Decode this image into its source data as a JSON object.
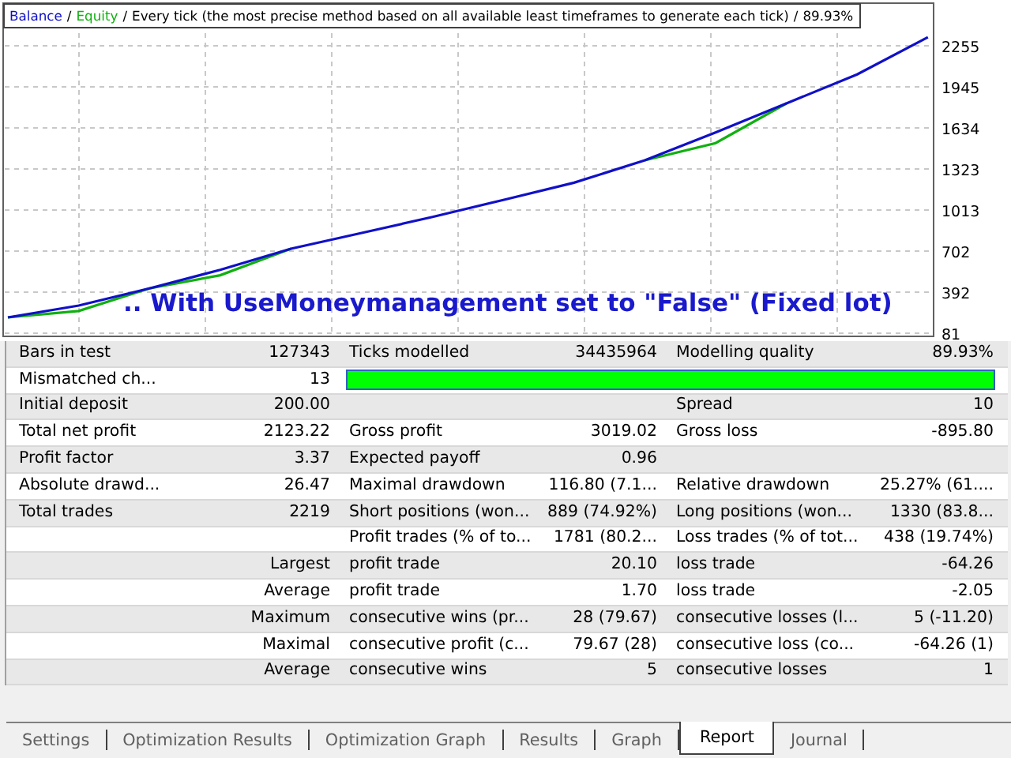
{
  "chart": {
    "header": [
      {
        "text": "Balance",
        "color": "#1010c8"
      },
      {
        "text": "/"
      },
      {
        "text": "Equity",
        "color": "#10b010"
      },
      {
        "text": "/"
      },
      {
        "text": "Every tick (the most precise method based on all available least timeframes to generate each tick)"
      },
      {
        "text": "/"
      },
      {
        "text": "89.93%"
      }
    ],
    "overlay_text": ".. With UseMoneymanagement set to \"False\" (Fixed lot)",
    "y_axis_labels": [
      "2255",
      "1945",
      "1634",
      "1323",
      "1013",
      "702",
      "392",
      "81"
    ]
  },
  "table": {
    "rows": [
      {
        "kind": "pair",
        "cells": [
          "Bars in test",
          "127343",
          "Ticks modelled",
          "34435964",
          "Modelling quality",
          "89.93%"
        ]
      },
      {
        "kind": "quality_bar",
        "cells": [
          "Mismatched ch...",
          "13"
        ],
        "level": 1.0
      },
      {
        "kind": "pair",
        "cells": [
          "Initial deposit",
          "200.00",
          null,
          null,
          "Spread",
          "10"
        ]
      },
      {
        "kind": "pair",
        "cells": [
          "Total net profit",
          "2123.22",
          "Gross profit",
          "3019.02",
          "Gross loss",
          "-895.80"
        ]
      },
      {
        "kind": "pair",
        "cells": [
          "Profit factor",
          "3.37",
          "Expected payoff",
          "0.96",
          null,
          null
        ]
      },
      {
        "kind": "pair",
        "cells": [
          "Absolute drawd...",
          "26.47",
          "Maximal drawdown",
          "116.80 (7.1...",
          "Relative drawdown",
          "25.27% (61...."
        ]
      },
      {
        "kind": "pair",
        "cells": [
          "Total trades",
          "2219",
          "Short positions (won...",
          "889 (74.92%)",
          "Long positions (won...",
          "1330 (83.8..."
        ]
      },
      {
        "kind": "detail",
        "cells": [
          null,
          null,
          "Profit trades (% of to...",
          "1781 (80.2...",
          "Loss trades (% of tot...",
          "438 (19.74%)"
        ]
      },
      {
        "kind": "detail",
        "cells": [
          null,
          "Largest",
          "profit trade",
          "20.10",
          "loss trade",
          "-64.26"
        ]
      },
      {
        "kind": "detail",
        "cells": [
          null,
          "Average",
          "profit trade",
          "1.70",
          "loss trade",
          "-2.05"
        ]
      },
      {
        "kind": "detail",
        "cells": [
          null,
          "Maximum",
          "consecutive wins (pr...",
          "28 (79.67)",
          "consecutive losses (l...",
          "5 (-11.20)"
        ]
      },
      {
        "kind": "detail",
        "cells": [
          null,
          "Maximal",
          "consecutive profit (c...",
          "79.67 (28)",
          "consecutive loss (co...",
          "-64.26 (1)"
        ]
      },
      {
        "kind": "detail",
        "cells": [
          null,
          "Average",
          "consecutive wins",
          "5",
          "consecutive losses",
          "1"
        ]
      }
    ]
  },
  "tabs": [
    {
      "label": "Settings",
      "selected": false
    },
    {
      "label": "Optimization Results",
      "selected": false
    },
    {
      "label": "Optimization Graph",
      "selected": false
    },
    {
      "label": "Results",
      "selected": false
    },
    {
      "label": "Graph",
      "selected": false
    },
    {
      "label": "Report",
      "selected": true
    },
    {
      "label": "Journal",
      "selected": false
    }
  ]
}
